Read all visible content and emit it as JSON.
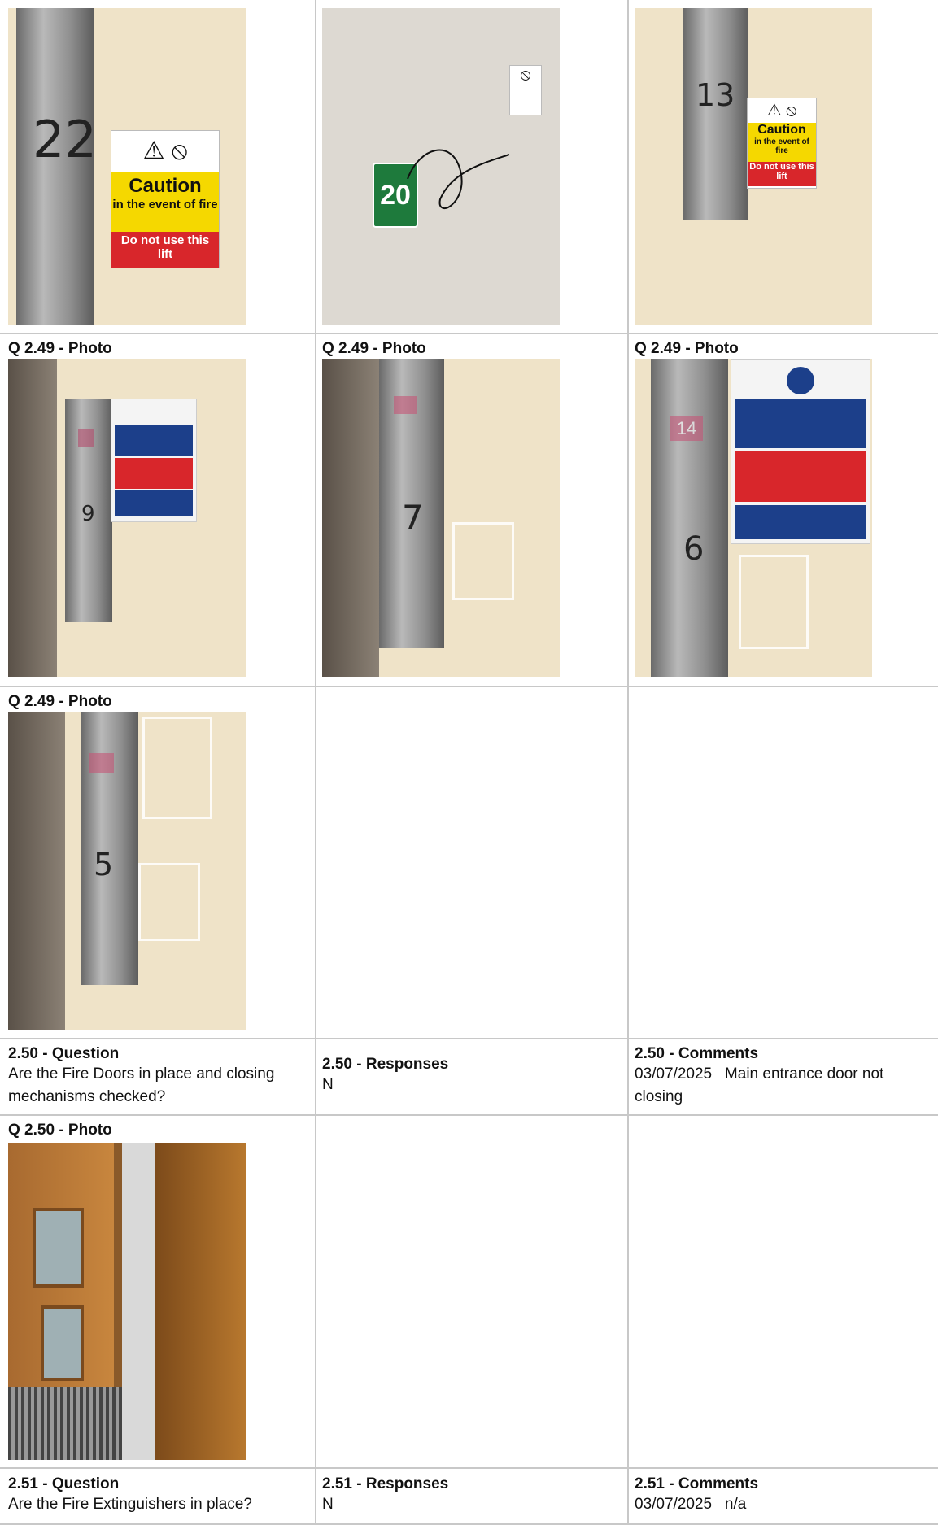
{
  "rows": [
    {
      "labels": [
        "",
        "",
        ""
      ]
    },
    {
      "labels": [
        "Q 2.49 - Photo",
        "Q 2.49 - Photo",
        "Q 2.49 - Photo"
      ]
    },
    {
      "labels": [
        "Q 2.49 - Photo"
      ]
    }
  ],
  "photos": {
    "p1": {
      "number": "22",
      "caution": "Caution",
      "caution_sub": "in the event of fire",
      "donot": "Do not use this lift"
    },
    "p2": {
      "number": "20"
    },
    "p3": {
      "number": "13",
      "caution": "Caution",
      "caution_sub": "in the event of fire",
      "donot": "Do not use this lift"
    },
    "p4": {
      "number": "9"
    },
    "p5": {
      "number": "7"
    },
    "p6": {
      "number": "6",
      "display": "14"
    },
    "p7": {
      "number": "5"
    }
  },
  "q250": {
    "question_label": "2.50 - Question",
    "question_text": "Are the Fire Doors in place and closing mechanisms checked?",
    "responses_label": "2.50 - Responses",
    "responses_value": "N",
    "comments_label": "2.50 - Comments",
    "comments_value": "03/07/2025   Main entrance door not closing",
    "photo_label": "Q 2.50 - Photo"
  },
  "q251": {
    "question_label": "2.51 - Question",
    "question_text": "Are the Fire Extinguishers in place?",
    "responses_label": "2.51 - Responses",
    "responses_value": "N",
    "comments_label": "2.51 - Comments",
    "comments_value": "03/07/2025   n/a"
  },
  "colors": {
    "grid": "#c8c8c8",
    "caution_yellow": "#f5d800",
    "caution_red": "#d8262b",
    "exit_green": "#1e7a3c",
    "fire_action_blue": "#1c3f8a"
  }
}
